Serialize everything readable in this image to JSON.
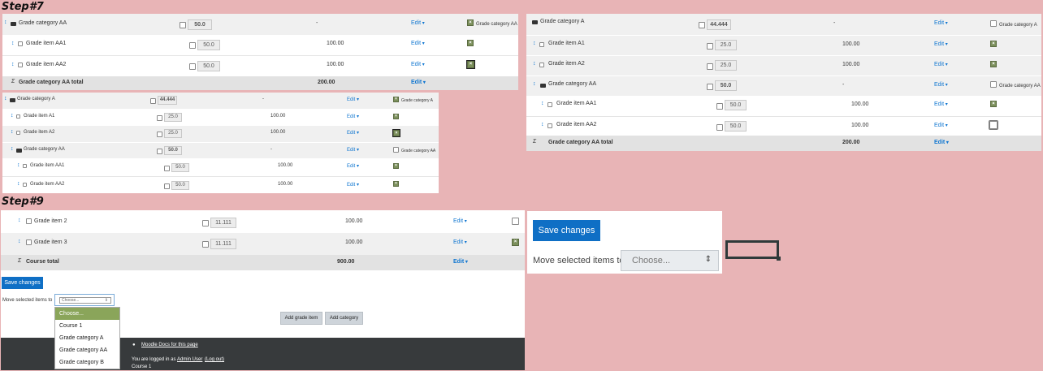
{
  "steps": {
    "step7": "Step#7",
    "step9": "Step#9"
  },
  "p1": {
    "rows": [
      {
        "name": "Grade category AA",
        "weight": "50.0",
        "total": "-",
        "edit": "Edit",
        "status_label": "Grade category AA"
      },
      {
        "name": "Grade item AA1",
        "weight": "50.0",
        "total": "100.00",
        "edit": "Edit"
      },
      {
        "name": "Grade item AA2",
        "weight": "50.0",
        "total": "100.00",
        "edit": "Edit"
      },
      {
        "name": "Grade category AA total",
        "total": "200.00",
        "edit": "Edit"
      }
    ]
  },
  "p2": {
    "rows": [
      {
        "name": "Grade category A",
        "weight": "44.444",
        "total": "-",
        "edit": "Edit",
        "status_label": "Grade category A"
      },
      {
        "name": "Grade item A1",
        "weight": "25.0",
        "total": "100.00",
        "edit": "Edit"
      },
      {
        "name": "Grade item A2",
        "weight": "25.0",
        "total": "100.00",
        "edit": "Edit"
      },
      {
        "name": "Grade category AA",
        "weight": "50.0",
        "total": "-",
        "edit": "Edit",
        "status_label": "Grade category AA"
      },
      {
        "name": "Grade item AA1",
        "weight": "50.0",
        "total": "100.00",
        "edit": "Edit"
      },
      {
        "name": "Grade item AA2",
        "weight": "50.0",
        "total": "100.00",
        "edit": "Edit"
      }
    ]
  },
  "p3": {
    "rows": [
      {
        "name": "Grade category A",
        "weight": "44.444",
        "total": "-",
        "edit": "Edit",
        "status_label": "Grade category A"
      },
      {
        "name": "Grade item A1",
        "weight": "25.0",
        "total": "100.00",
        "edit": "Edit"
      },
      {
        "name": "Grade item A2",
        "weight": "25.0",
        "total": "100.00",
        "edit": "Edit"
      },
      {
        "name": "Grade category AA",
        "weight": "50.0",
        "total": "-",
        "edit": "Edit",
        "status_label": "Grade category AA"
      },
      {
        "name": "Grade item AA1",
        "weight": "50.0",
        "total": "100.00",
        "edit": "Edit"
      },
      {
        "name": "Grade item AA2",
        "weight": "50.0",
        "total": "100.00",
        "edit": "Edit"
      },
      {
        "name": "Grade category AA total",
        "total": "200.00",
        "edit": "Edit"
      }
    ]
  },
  "p4": {
    "rows": [
      {
        "name": "Grade item 2",
        "weight": "11.111",
        "total": "100.00",
        "edit": "Edit"
      },
      {
        "name": "Grade item 3",
        "weight": "11.111",
        "total": "100.00",
        "edit": "Edit"
      },
      {
        "name": "Course total",
        "total": "900.00",
        "edit": "Edit"
      }
    ],
    "save_label": "Save changes",
    "move_label": "Move selected items to",
    "select_value": "Choose...",
    "add_grade_item": "Add grade item",
    "add_category": "Add category",
    "dropdown_options": [
      "Choose...",
      "Course 1",
      "Grade category A",
      "Grade category AA",
      "Grade category B"
    ],
    "footer": {
      "docs_link": "Moodle Docs for this page",
      "logged_in_prefix": "You are logged in as",
      "user_link": "Admin User",
      "logout_link": "(Log out)",
      "course": "Course 1"
    }
  },
  "p5": {
    "save_label": "Save changes",
    "move_label": "Move selected items to",
    "select_value": "Choose..."
  }
}
